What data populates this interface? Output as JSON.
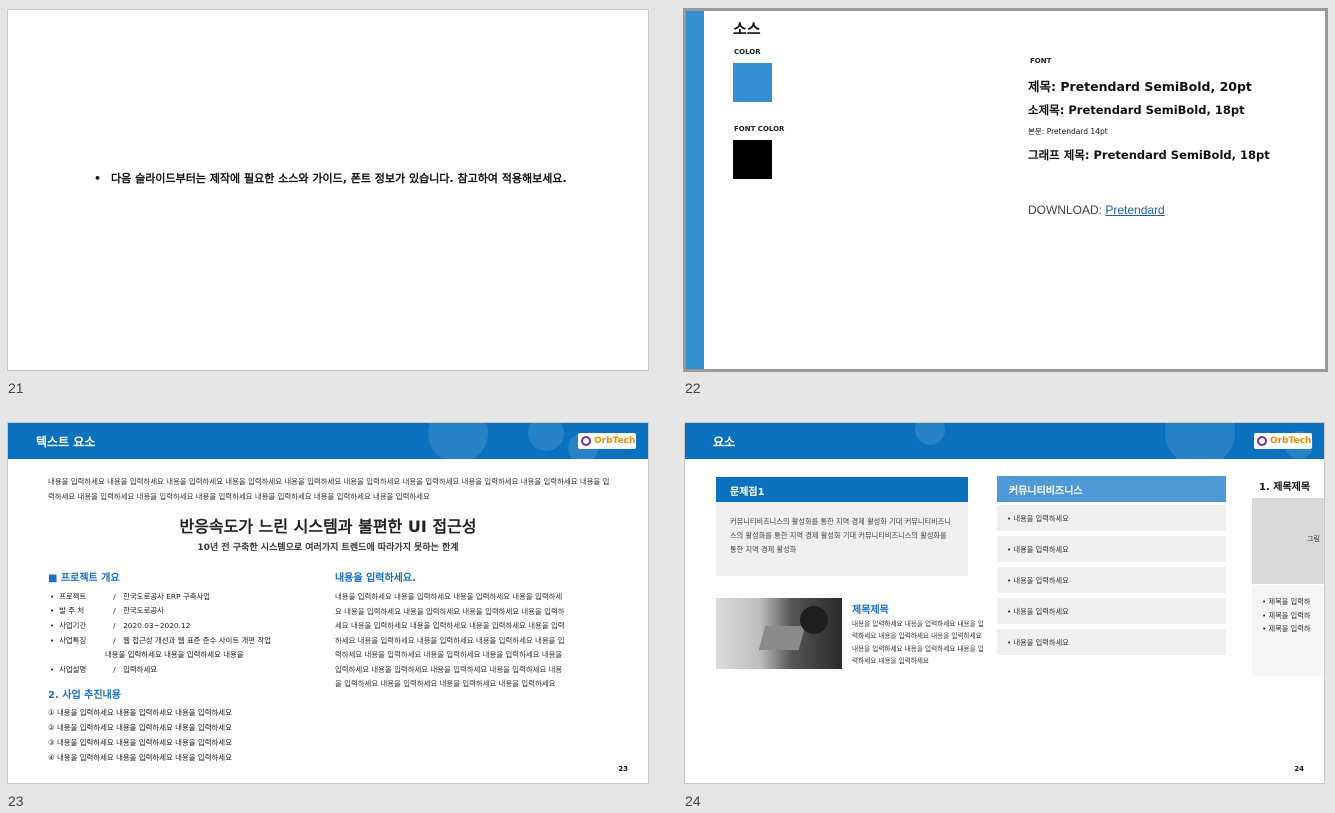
{
  "slides": {
    "s21": {
      "number": "21",
      "bullet": "다음 슬라이드부터는 제작에  필요한 소스와 가이드, 폰트 정보가 있습니다. 참고하여 적용해보세요."
    },
    "s22": {
      "number": "22",
      "title": "소스",
      "color_label": "COLOR",
      "font_color_label": "FONT COLOR",
      "font_label": "FONT",
      "color_swatch": "#3490d0",
      "font_color_swatch": "#000000",
      "font_lines": [
        "제목: Pretendard SemiBold, 20pt",
        "소제목: Pretendard SemiBold, 18pt",
        "본문: Pretendard 14pt",
        "그래프 제목: Pretendard SemiBold, 18pt"
      ],
      "download_label": "DOWNLOAD:",
      "download_link": "Pretendard"
    },
    "s23": {
      "number": "23",
      "header": "텍스트 요소",
      "logo": "OrbTech",
      "intro": "내용을 입력하세요 내용을 입력하세요 내용을 입력하세요 내용을 입력하세요 내용을 입력하세요 내용을 입력하세요 내용을 입력하세요 내용을 입력하세요 내용을 입력하세요 내용을 입력하세요 내용을 입력하세요 내용을 입력하세요 내용을 입력하세요 내용을 입력하세요 내용을 입력하세요 내용을 입력하세요",
      "headline": "반응속도가 느린 시스템과 불편한 UI 접근성",
      "subheadline": "10년 전 구축한 시스템으로 여러가지 트렌드에 따라가지 못하는 한계",
      "section1": "■ 프로젝트 개요",
      "rows": [
        {
          "k": "프로젝트",
          "v": "한국도로공사 ERP 구축사업"
        },
        {
          "k": "발 주 처",
          "v": "한국도로공사"
        },
        {
          "k": "사업기간",
          "v": "2020.03~2020.12"
        },
        {
          "k": "사업특징",
          "v": "웹 접근성 개선과 웹 표준 준수 사이트 개편 작업"
        },
        {
          "k": "",
          "v": "내용을 입력하세요 내용을 입력하세요 내용을"
        },
        {
          "k": "사업설명",
          "v": "입력하세요"
        }
      ],
      "section2": "2. 사업 추진내용",
      "steps": [
        "① 내용을 입력하세요 내용을 입력하세요 내용을 입력하세요",
        "② 내용을 입력하세요 내용을 입력하세요 내용을 입력하세요",
        "③ 내용을 입력하세요 내용을 입력하세요 내용을 입력하세요",
        "④ 내용을 입력하세요 내용을 입력하세요 내용을 입력하세요"
      ],
      "right_title": "내용을 입력하세요.",
      "right_para": "내용을 입력하세요 내용을 입력하세요 내용을 입력하세요 내용을 입력하세요 내용을 입력하세요 내용을 입력하세요 내용을 입력하세요 내용을 입력하세요 내용을 입력하세요 내용을 입력하세요 내용을 입력하세요 내용을 입력하세요 내용을 입력하세요 내용을 입력하세요 내용을 입력하세요 내용을 입력하세요 내용을 입력하세요 내용을 입력하세요 내용을 입력하세요 내용을 입력하세요 내용을 입력하세요 내용을 입력하세요 내용을 입력하세요 내용을 입력하세요 내용을 입력하세요 내용을 입력하세요 내용을 입력하세요",
      "page": "23"
    },
    "s24": {
      "number": "24",
      "header": "요소",
      "logo": "OrbTech",
      "box_title": "문제점1",
      "box_text": "커뮤니티비즈니스의 활성화를 통한 지역 경제 활성화 기대 커뮤니티비즈니스의 활성화를 통한 지역 경제 활성화 기대 커뮤니티비즈니스의 활성화를 통한 지역 경제 활성화",
      "photo_title": "제목제목",
      "photo_text": "내용을 입력하세요 내용을 입력하세요 내용을 입력하세요 내용을 입력하세요 내용을 입력하세요 내용을 입력하세요 내용을 입력하세요 내용을 입력하세요 내용을 입력하세요",
      "community_title": "커뮤니티비즈니스",
      "community_items": [
        "• 내용을 입력하세요",
        "• 내용을 입력하세요",
        "• 내용을 입력하세요",
        "• 내용을 입력하세요",
        "• 내용을 입력하세요"
      ],
      "right_title": "1. 제목제목",
      "right_img_label": "그림",
      "right_items": [
        "•  제목을 입력하",
        "•  제목을 입력하",
        "•  제목을 입력하"
      ],
      "page": "24"
    }
  }
}
